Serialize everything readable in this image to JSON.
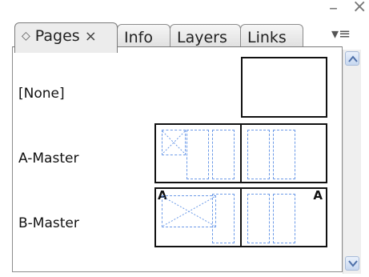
{
  "tabs": [
    {
      "label": "Pages",
      "close": "×",
      "active": true
    },
    {
      "label": "Info",
      "active": false
    },
    {
      "label": "Layers",
      "active": false
    },
    {
      "label": "Links",
      "active": false
    }
  ],
  "window_controls": {
    "minimize": "–",
    "close": "×"
  },
  "flyout_menu": "▾≡",
  "masters": [
    {
      "label": "[None]",
      "prefix_left": "",
      "prefix_right": ""
    },
    {
      "label": "A-Master",
      "prefix_left": "",
      "prefix_right": ""
    },
    {
      "label": "B-Master",
      "prefix_left": "A",
      "prefix_right": "A"
    }
  ],
  "colors": {
    "guide": "#6d9be8",
    "border": "#111111"
  }
}
